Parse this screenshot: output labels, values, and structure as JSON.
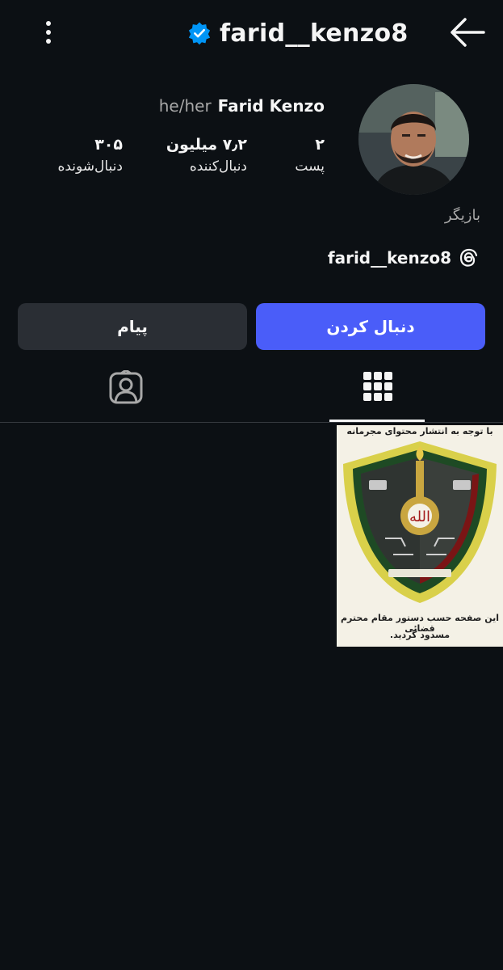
{
  "header": {
    "username": "farid__kenzo8"
  },
  "profile": {
    "pronouns": "he/her",
    "full_name": "Farid Kenzo",
    "category": "بازیگر",
    "threads_handle": "farid__kenzo8",
    "stats": {
      "posts": {
        "value": "۲",
        "label": "پست"
      },
      "followers": {
        "value": "۷٫۲ میلیون",
        "label": "دنبال‌کننده"
      },
      "following": {
        "value": "۳۰۵",
        "label": "دنبال‌شونده"
      }
    }
  },
  "actions": {
    "follow_label": "دنبال کردن",
    "message_label": "پیام"
  },
  "tabs": {
    "active": "posts-grid"
  },
  "post": {
    "top_text": "با توجه به انتشار محتوای مجرمانه",
    "bottom_text_1": "این صفحه حسب دستور مقام محترم قضائی",
    "bottom_text_2": "مسدود گردید."
  },
  "colors": {
    "background": "#0c1014",
    "accent": "#4a5df9",
    "verified": "#0095f6"
  },
  "icons": {
    "more": "more-vertical-icon",
    "verified": "verified-badge-icon",
    "back": "arrow-right-icon",
    "threads": "threads-icon",
    "grid": "grid-icon",
    "tagged": "tagged-person-icon"
  }
}
